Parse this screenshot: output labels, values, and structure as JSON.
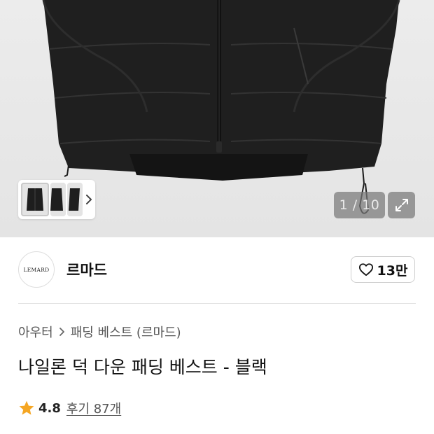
{
  "gallery": {
    "counter": "1 / 10"
  },
  "brand": {
    "logo_text": "LEMARD",
    "name": "르마드",
    "like_count": "13만"
  },
  "product": {
    "breadcrumb": [
      "아우터",
      "패딩 베스트 (르마드)"
    ],
    "title": "나일론 덕 다운 패딩 베스트 - 블랙",
    "rating": "4.8",
    "review_link": "후기 87개"
  },
  "colors": {
    "star": "#f5a623",
    "garment": "#1e1e1e",
    "background": "#e8e8e8"
  },
  "icons": [
    "chevron-right-icon",
    "expand-icon",
    "heart-outline-icon",
    "star-icon"
  ]
}
